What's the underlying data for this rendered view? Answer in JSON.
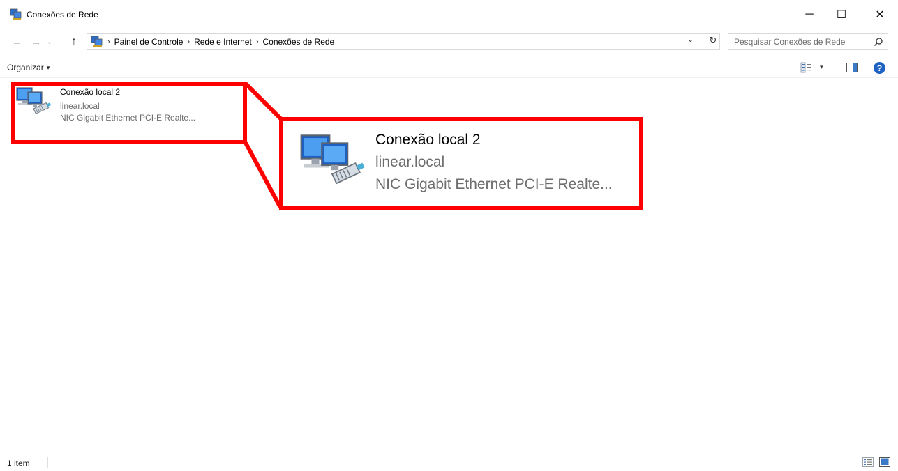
{
  "window": {
    "title": "Conexões de Rede",
    "minimize_label": "─",
    "maximize_label": "☐",
    "close_label": "✕"
  },
  "nav": {
    "back_label": "←",
    "forward_label": "→",
    "recent_label": "⌄",
    "up_label": "↑"
  },
  "breadcrumb": {
    "separator": "›",
    "items": [
      "Painel de Controle",
      "Rede e Internet",
      "Conexões de Rede"
    ],
    "dropdown_label": "⌄",
    "refresh_label": "↻"
  },
  "search": {
    "placeholder": "Pesquisar Conexões de Rede"
  },
  "toolbar": {
    "organize_label": "Organizar",
    "organize_caret": "▾",
    "view_caret": "▾",
    "help_label": "?"
  },
  "connection": {
    "name": "Conexão local 2",
    "domain": "linear.local",
    "adapter": "NIC Gigabit Ethernet PCI-E Realte..."
  },
  "status": {
    "item_count": "1 item"
  },
  "colors": {
    "highlight": "#ff0000",
    "accent": "#1e63c4",
    "secondary_text": "#6d6d6d"
  },
  "icons": [
    "network-connections-icon",
    "search-icon",
    "view-options-icon",
    "preview-pane-icon",
    "help-icon",
    "network-adapter-icon",
    "details-view-icon",
    "large-icons-view-icon"
  ]
}
